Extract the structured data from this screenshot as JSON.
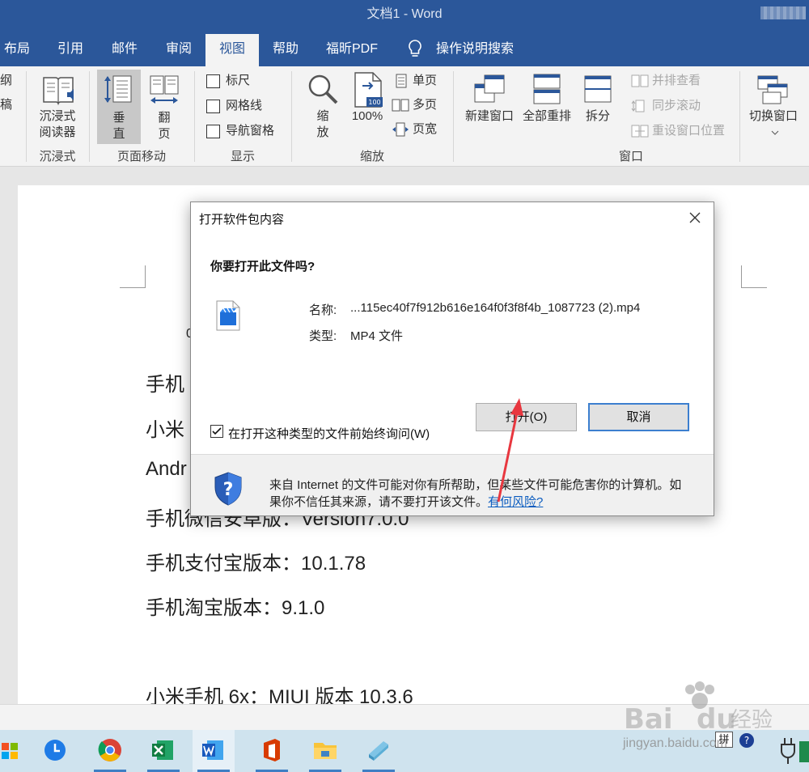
{
  "window": {
    "title": "文档1  -  Word"
  },
  "tabs": [
    {
      "label": "布局"
    },
    {
      "label": "引用"
    },
    {
      "label": "邮件"
    },
    {
      "label": "审阅"
    },
    {
      "label": "视图"
    },
    {
      "label": "帮助"
    },
    {
      "label": "福昕PDF"
    },
    {
      "label": "操作说明搜索"
    }
  ],
  "ribbon": {
    "left_cut": {
      "top": "纲",
      "bottom": "稿"
    },
    "immersive": {
      "button": "沉浸式\n阅读器",
      "group": "沉浸式"
    },
    "pagemove": {
      "vertical": "垂\n直",
      "flip": "翻\n页",
      "group": "页面移动"
    },
    "show": {
      "ruler": "标尺",
      "grid": "网格线",
      "nav": "导航窗格",
      "group": "显示"
    },
    "zoom": {
      "zoom": "缩\n放",
      "percent": "100%",
      "hundred_badge": "100",
      "one_page": "单页",
      "multi_page": "多页",
      "page_width": "页宽",
      "group": "缩放"
    },
    "window": {
      "new": "新建窗口",
      "arrange": "全部重排",
      "split": "拆分",
      "side_by_side": "并排查看",
      "sync_scroll": "同步滚动",
      "reset_pos": "重设窗口位置",
      "switch": "切换窗口",
      "group": "窗口"
    }
  },
  "document": {
    "lines": [
      {
        "text": "手机"
      },
      {
        "text": "小米"
      },
      {
        "text": "Andr"
      },
      {
        "text": "手机微信安卓版：Version7.0.0"
      },
      {
        "text": "手机支付宝版本：10.1.78"
      },
      {
        "text": "手机淘宝版本：9.1.0"
      },
      {
        "text": "小米手机 6x：MIUI 版本 10.3.6"
      }
    ],
    "stray_char": "0"
  },
  "dialog": {
    "title": "打开软件包内容",
    "question": "你要打开此文件吗?",
    "name_label": "名称:",
    "name_value": "...115ec40f7f912b616e164f0f3f8f4b_1087723 (2).mp4",
    "type_label": "类型:",
    "type_value": "MP4 文件",
    "open_button": "打开(O)",
    "cancel_button": "取消",
    "always_ask": "在打开这种类型的文件前始终询问(W)",
    "always_ask_checked": true,
    "warning_text": "来自 Internet 的文件可能对你有所帮助，但某些文件可能危害你的计算机。如果你不信任其来源，请不要打开该文件。",
    "risk_link": "有何风险?"
  },
  "taskbar": {
    "icons": [
      "store-icon",
      "clock-icon",
      "chrome-icon",
      "excel-icon",
      "word-icon",
      "office-icon",
      "explorer-icon",
      "notepad-icon"
    ],
    "ime": "拼"
  },
  "watermark": {
    "logo": "Baidu经验",
    "url": "jingyan.baidu.com"
  },
  "colors": {
    "word_blue": "#2b579a",
    "link": "#0b5cbf",
    "accent_button_border": "#3c7fcf",
    "arrow": "#e8373f"
  }
}
